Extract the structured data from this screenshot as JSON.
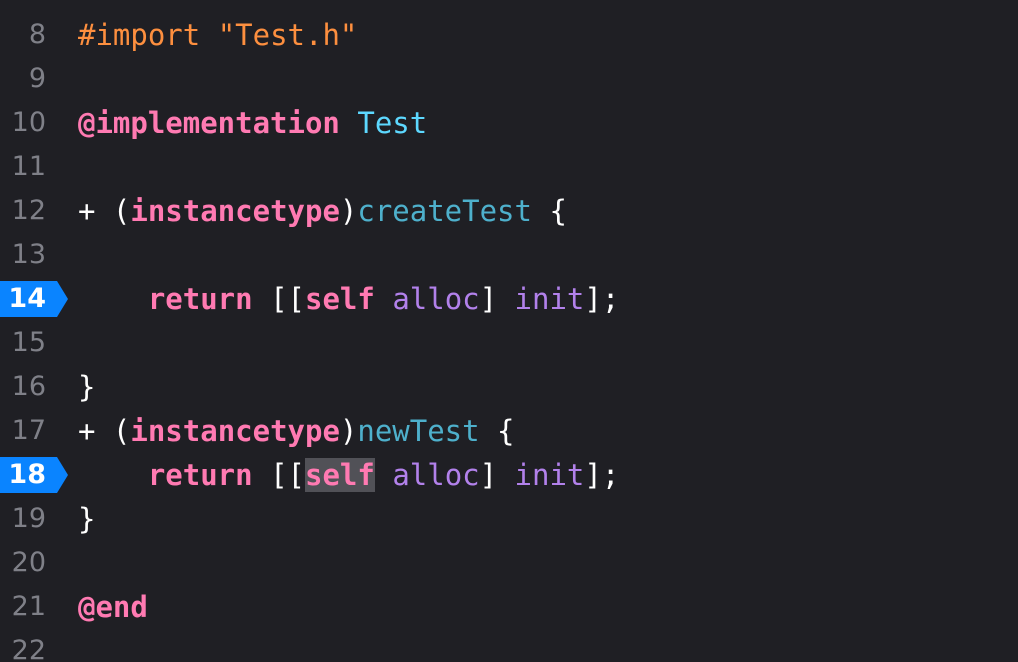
{
  "editor": {
    "lines": [
      {
        "num": "8",
        "breakpoint": false,
        "tokens": [
          {
            "t": "#import ",
            "c": "pre"
          },
          {
            "t": "\"Test.h\"",
            "c": "pre"
          }
        ]
      },
      {
        "num": "9",
        "breakpoint": false,
        "tokens": []
      },
      {
        "num": "10",
        "breakpoint": false,
        "tokens": [
          {
            "t": "@implementation",
            "c": "kw"
          },
          {
            "t": " ",
            "c": "punc"
          },
          {
            "t": "Test",
            "c": "type"
          }
        ]
      },
      {
        "num": "11",
        "breakpoint": false,
        "tokens": []
      },
      {
        "num": "12",
        "breakpoint": false,
        "tokens": [
          {
            "t": "+ (",
            "c": "punc"
          },
          {
            "t": "instancetype",
            "c": "kw"
          },
          {
            "t": ")",
            "c": "punc"
          },
          {
            "t": "createTest",
            "c": "fncyan"
          },
          {
            "t": " {",
            "c": "punc"
          }
        ]
      },
      {
        "num": "13",
        "breakpoint": false,
        "tokens": []
      },
      {
        "num": "14",
        "breakpoint": true,
        "tokens": [
          {
            "t": "    ",
            "c": "punc"
          },
          {
            "t": "return",
            "c": "kw"
          },
          {
            "t": " [[",
            "c": "punc"
          },
          {
            "t": "self",
            "c": "kw"
          },
          {
            "t": " ",
            "c": "punc"
          },
          {
            "t": "alloc",
            "c": "call"
          },
          {
            "t": "] ",
            "c": "punc"
          },
          {
            "t": "init",
            "c": "call"
          },
          {
            "t": "];",
            "c": "punc"
          }
        ]
      },
      {
        "num": "15",
        "breakpoint": false,
        "tokens": []
      },
      {
        "num": "16",
        "breakpoint": false,
        "tokens": [
          {
            "t": "}",
            "c": "punc"
          }
        ]
      },
      {
        "num": "17",
        "breakpoint": false,
        "tokens": [
          {
            "t": "+ (",
            "c": "punc"
          },
          {
            "t": "instancetype",
            "c": "kw"
          },
          {
            "t": ")",
            "c": "punc"
          },
          {
            "t": "newTest",
            "c": "fncyan"
          },
          {
            "t": " {",
            "c": "punc"
          }
        ]
      },
      {
        "num": "18",
        "breakpoint": true,
        "tokens": [
          {
            "t": "    ",
            "c": "punc"
          },
          {
            "t": "return",
            "c": "kw"
          },
          {
            "t": " [[",
            "c": "punc"
          },
          {
            "t": "self",
            "c": "kw",
            "highlight": true
          },
          {
            "t": " ",
            "c": "punc"
          },
          {
            "t": "alloc",
            "c": "call"
          },
          {
            "t": "] ",
            "c": "punc"
          },
          {
            "t": "init",
            "c": "call"
          },
          {
            "t": "];",
            "c": "punc"
          }
        ]
      },
      {
        "num": "19",
        "breakpoint": false,
        "tokens": [
          {
            "t": "}",
            "c": "punc"
          }
        ]
      },
      {
        "num": "20",
        "breakpoint": false,
        "tokens": []
      },
      {
        "num": "21",
        "breakpoint": false,
        "tokens": [
          {
            "t": "@end",
            "c": "kw"
          }
        ]
      },
      {
        "num": "22",
        "breakpoint": false,
        "tokens": []
      }
    ]
  },
  "colors": {
    "background": "#1f1f24",
    "line_number": "#7f8088",
    "breakpoint": "#0a84ff",
    "preprocessor": "#fd8f3f",
    "keyword": "#ff7ab2",
    "type": "#5dd8ff",
    "method_name": "#4eb0cc",
    "method_call": "#b281eb",
    "plain": "#ffffff",
    "selection": "#515157"
  }
}
